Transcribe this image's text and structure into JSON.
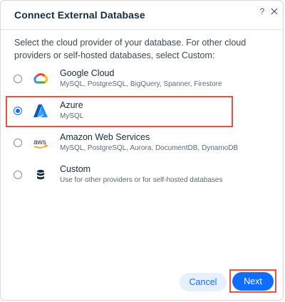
{
  "dialog": {
    "title": "Connect External Database",
    "help_label": "?",
    "intro": "Select the cloud provider of your database. For other cloud providers or self-hosted databases, select Custom:"
  },
  "options": [
    {
      "title": "Google Cloud",
      "subtitle": "MySQL, PostgreSQL, BigQuery, Spanner, Firestore",
      "icon": "google-cloud-icon",
      "selected": false
    },
    {
      "title": "Azure",
      "subtitle": "MySQL",
      "icon": "azure-icon",
      "selected": true
    },
    {
      "title": "Amazon Web Services",
      "subtitle": "MySQL, PostgreSQL, Aurora, DocumentDB, DynamoDB",
      "icon": "aws-icon",
      "logo_text": "aws",
      "selected": false
    },
    {
      "title": "Custom",
      "subtitle": "Use for other providers or for self-hosted databases",
      "icon": "database-icon",
      "selected": false
    }
  ],
  "footer": {
    "cancel_label": "Cancel",
    "next_label": "Next"
  },
  "colors": {
    "accent": "#116dff",
    "highlight": "#e8533f"
  }
}
